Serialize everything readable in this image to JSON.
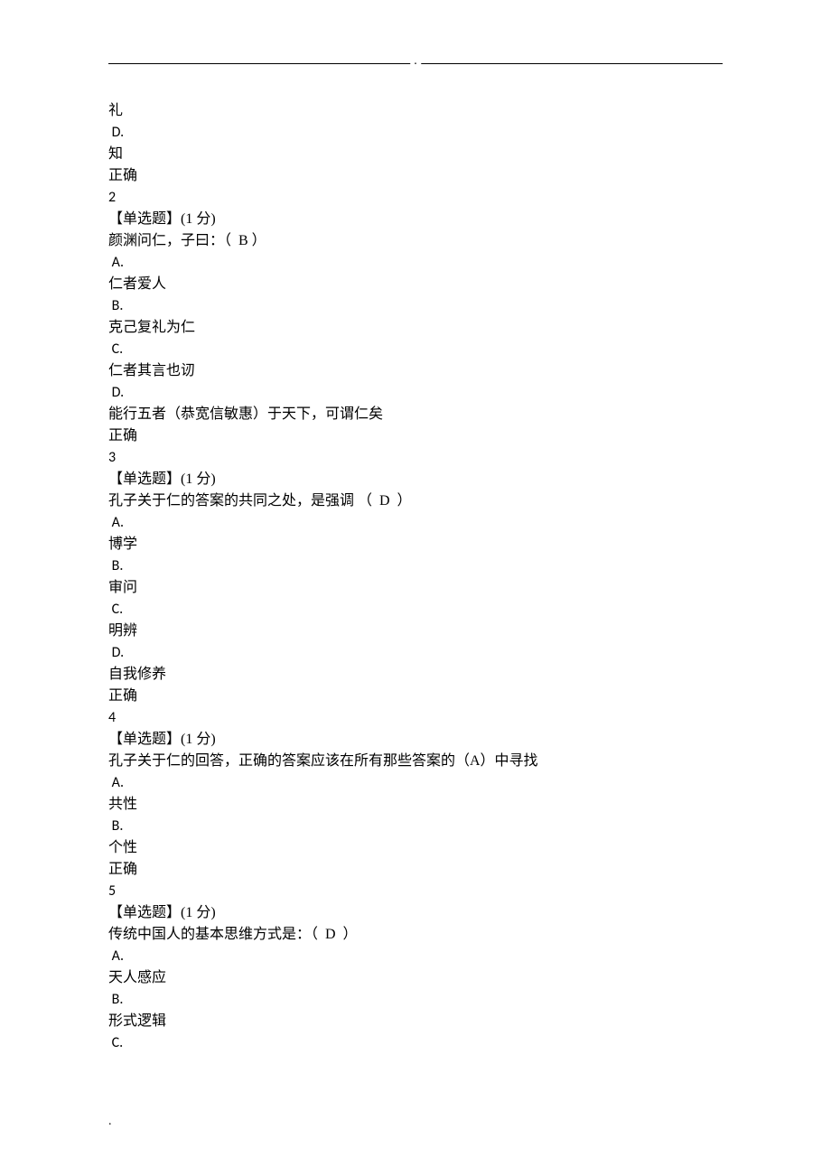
{
  "header": {
    "dot": "."
  },
  "footer": {
    "dot": "."
  },
  "lines": [
    {
      "t": "礼",
      "latin": false
    },
    {
      "t": " D.",
      "latin": true
    },
    {
      "t": "知",
      "latin": false
    },
    {
      "t": "正确",
      "latin": false
    },
    {
      "t": "2",
      "latin": true
    },
    {
      "t": "【单选题】(1 分)",
      "latin": false
    },
    {
      "t": "颜渊问仁，子曰：（  B ）",
      "latin": false
    },
    {
      "t": " A.",
      "latin": true
    },
    {
      "t": "仁者爱人",
      "latin": false
    },
    {
      "t": " B.",
      "latin": true
    },
    {
      "t": "克己复礼为仁",
      "latin": false
    },
    {
      "t": " C.",
      "latin": true
    },
    {
      "t": "仁者其言也讱",
      "latin": false
    },
    {
      "t": " D.",
      "latin": true
    },
    {
      "t": "能行五者（恭宽信敏惠）于天下，可谓仁矣",
      "latin": false
    },
    {
      "t": "正确",
      "latin": false
    },
    {
      "t": "3",
      "latin": true
    },
    {
      "t": "【单选题】(1 分)",
      "latin": false
    },
    {
      "t": "孔子关于仁的答案的共同之处，是强调 （  D  ）",
      "latin": false
    },
    {
      "t": " A.",
      "latin": true
    },
    {
      "t": "博学",
      "latin": false
    },
    {
      "t": " B.",
      "latin": true
    },
    {
      "t": "审问",
      "latin": false
    },
    {
      "t": " C.",
      "latin": true
    },
    {
      "t": "明辨",
      "latin": false
    },
    {
      "t": " D.",
      "latin": true
    },
    {
      "t": "自我修养",
      "latin": false
    },
    {
      "t": "正确",
      "latin": false
    },
    {
      "t": "4",
      "latin": true
    },
    {
      "t": "【单选题】(1 分)",
      "latin": false
    },
    {
      "t": "孔子关于仁的回答，正确的答案应该在所有那些答案的（A）中寻找",
      "latin": false
    },
    {
      "t": " A.",
      "latin": true
    },
    {
      "t": "共性",
      "latin": false
    },
    {
      "t": " B.",
      "latin": true
    },
    {
      "t": "个性",
      "latin": false
    },
    {
      "t": "正确",
      "latin": false
    },
    {
      "t": "5",
      "latin": true
    },
    {
      "t": "【单选题】(1 分)",
      "latin": false
    },
    {
      "t": "传统中国人的基本思维方式是：（  D  ）",
      "latin": false
    },
    {
      "t": " A.",
      "latin": true
    },
    {
      "t": "天人感应",
      "latin": false
    },
    {
      "t": " B.",
      "latin": true
    },
    {
      "t": "形式逻辑",
      "latin": false
    },
    {
      "t": " C.",
      "latin": true
    }
  ]
}
